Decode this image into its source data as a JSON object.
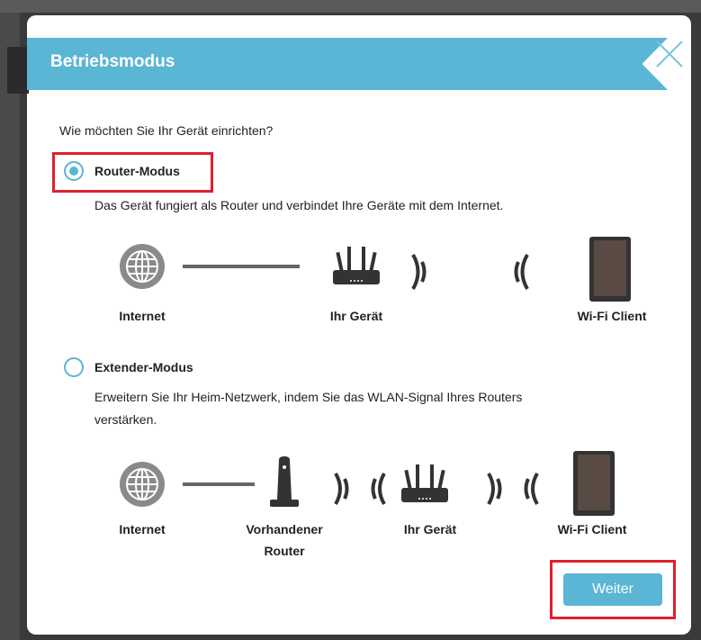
{
  "dialog": {
    "title": "Betriebsmodus",
    "question": "Wie möchten Sie Ihr Gerät einrichten?",
    "accent_color": "#5bb5d5",
    "highlight_color": "#e0202e"
  },
  "router_mode": {
    "label": "Router-Modus",
    "selected": true,
    "description": "Das Gerät fungiert als Router und verbindet Ihre Geräte mit dem Internet.",
    "diagram_labels": {
      "internet": "Internet",
      "device": "Ihr Gerät",
      "client": "Wi-Fi Client"
    }
  },
  "extender_mode": {
    "label": "Extender-Modus",
    "selected": false,
    "description_line1": "Erweitern Sie Ihr Heim-Netzwerk, indem Sie das WLAN-Signal Ihres Routers",
    "description_line2": "verstärken.",
    "diagram_labels": {
      "internet": "Internet",
      "existing_router_line1": "Vorhandener",
      "existing_router_line2": "Router",
      "device": "Ihr Gerät",
      "client": "Wi-Fi Client"
    }
  },
  "footer": {
    "next_label": "Weiter"
  },
  "icons": [
    "globe-icon",
    "router-icon",
    "wifi-signal-icon",
    "tablet-icon",
    "existing-router-icon",
    "close-icon"
  ]
}
